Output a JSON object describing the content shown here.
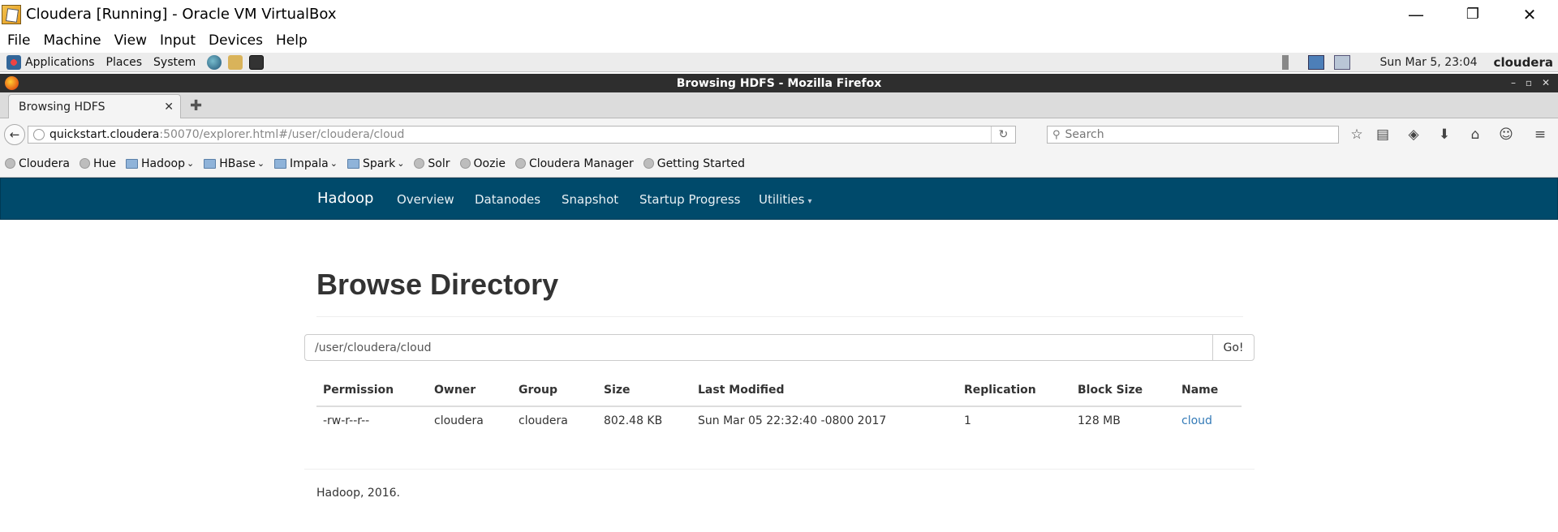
{
  "host_window": {
    "title": "Cloudera [Running] - Oracle VM VirtualBox",
    "controls": {
      "minimize": "—",
      "restore": "❐",
      "close": "✕"
    }
  },
  "host_menu": [
    "File",
    "Machine",
    "View",
    "Input",
    "Devices",
    "Help"
  ],
  "guest_panel": {
    "items": [
      "Applications",
      "Places",
      "System"
    ],
    "clock": "Sun Mar  5, 23:04",
    "user": "cloudera"
  },
  "firefox": {
    "window_title": "Browsing HDFS - Mozilla Firefox",
    "window_controls": {
      "minimize": "–",
      "maximize": "▫",
      "close": "✕"
    },
    "tab": {
      "label": "Browsing HDFS",
      "close": "✕"
    },
    "newtab": "✚",
    "back": "←",
    "url": {
      "host": "quickstart.cloudera",
      "rest": ":50070/explorer.html#/user/cloudera/cloud"
    },
    "reload": "↻",
    "search_placeholder": "Search",
    "toolbar_icons": [
      "☆",
      "▤",
      "◈",
      "⬇",
      "⌂",
      "☺",
      "≡"
    ],
    "bookmarks": [
      {
        "label": "Cloudera",
        "kind": "site"
      },
      {
        "label": "Hue",
        "kind": "site"
      },
      {
        "label": "Hadoop",
        "kind": "folder"
      },
      {
        "label": "HBase",
        "kind": "folder"
      },
      {
        "label": "Impala",
        "kind": "folder"
      },
      {
        "label": "Spark",
        "kind": "folder"
      },
      {
        "label": "Solr",
        "kind": "site"
      },
      {
        "label": "Oozie",
        "kind": "site"
      },
      {
        "label": "Cloudera Manager",
        "kind": "site"
      },
      {
        "label": "Getting Started",
        "kind": "site"
      }
    ],
    "caret": "⌄"
  },
  "hadoop": {
    "brand": "Hadoop",
    "nav": [
      "Overview",
      "Datanodes",
      "Snapshot",
      "Startup Progress",
      "Utilities"
    ],
    "utilities_caret": "▾",
    "page_title": "Browse Directory",
    "path_value": "/user/cloudera/cloud",
    "go_label": "Go!",
    "table": {
      "columns": [
        "Permission",
        "Owner",
        "Group",
        "Size",
        "Last Modified",
        "Replication",
        "Block Size",
        "Name"
      ],
      "rows": [
        [
          "-rw-r--r--",
          "cloudera",
          "cloudera",
          "802.48 KB",
          "Sun Mar 05 22:32:40 -0800 2017",
          "1",
          "128 MB",
          "cloud"
        ]
      ]
    },
    "footer": "Hadoop, 2016."
  },
  "colors": {
    "navbar_bg": "#004a6b",
    "link": "#337ab7"
  }
}
